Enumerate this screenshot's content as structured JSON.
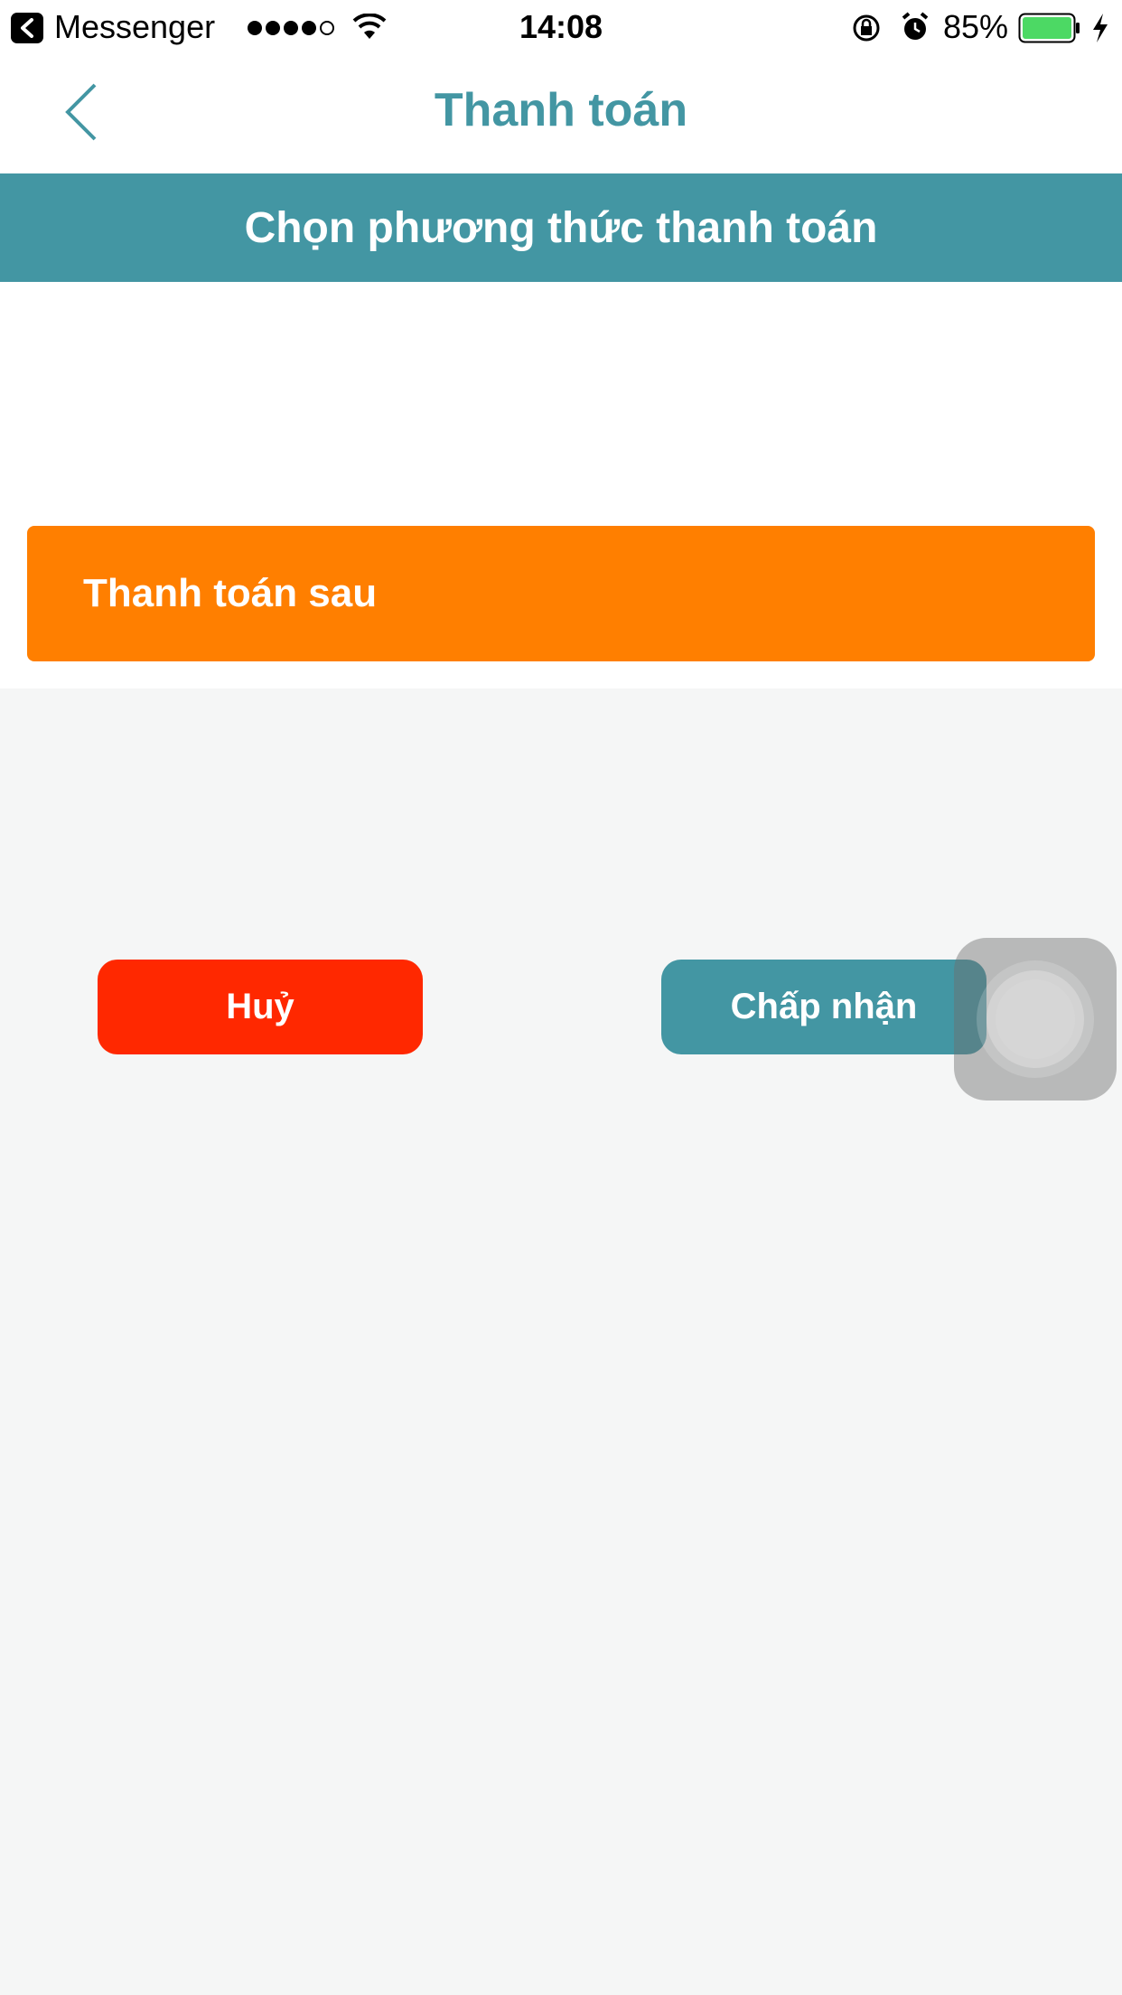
{
  "status_bar": {
    "back_app": "Messenger",
    "time": "14:08",
    "battery_percent": "85%",
    "signal_bars_filled": 4,
    "signal_bars_total": 5,
    "battery_color": "#4cd964"
  },
  "nav": {
    "title": "Thanh toán",
    "back_icon": "chevron-left-icon"
  },
  "section": {
    "header": "Chọn phương thức thanh toán"
  },
  "payment_options": [
    {
      "label": "Thanh toán sau",
      "color": "#ff7f00"
    }
  ],
  "actions": {
    "cancel_label": "Huỷ",
    "accept_label": "Chấp nhận"
  },
  "colors": {
    "accent": "#4396a3",
    "cancel": "#ff2800",
    "background": "#f5f6f6"
  }
}
